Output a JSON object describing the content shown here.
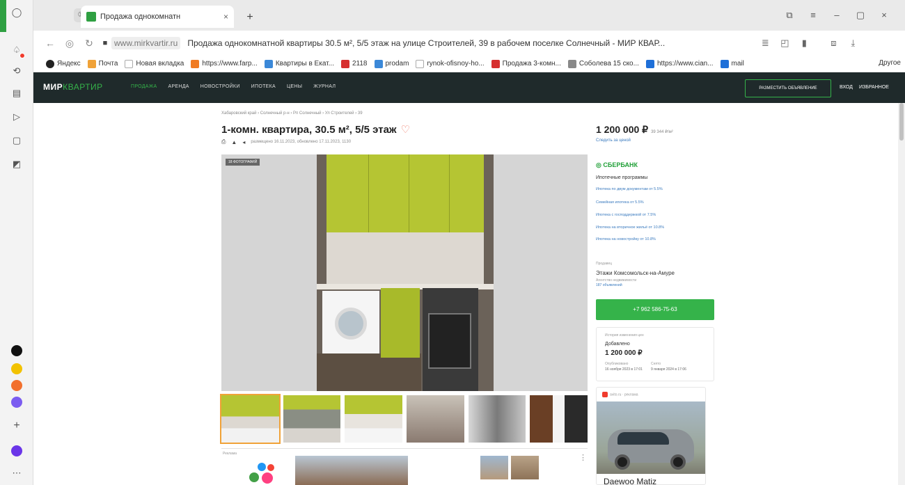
{
  "browser": {
    "tab_title": "Продажа однокомнатн",
    "domain": "www.mirkvartir.ru",
    "page_title": "Продажа однокомнатной квартиры 30.5 м², 5/5 этаж на улице Строителей, 39 в рабочем поселке Солнечный - МИР КВАР...",
    "bookmarks": [
      {
        "label": "Яндекс",
        "color": "#222222"
      },
      {
        "label": "Почта",
        "color": "#f0a238"
      },
      {
        "label": "Новая вкладка",
        "color": "#bdbdbd"
      },
      {
        "label": "https://www.farp...",
        "color": "#f07b22"
      },
      {
        "label": "Квартиры в Екат...",
        "color": "#3b88d8"
      },
      {
        "label": "2118",
        "color": "#d62f2f"
      },
      {
        "label": "prodam",
        "color": "#3b88d8"
      },
      {
        "label": "rynok-ofisnoy-ho...",
        "color": "#bdbdbd"
      },
      {
        "label": "Продажа 3-комн...",
        "color": "#d62f2f"
      },
      {
        "label": "Соболева 15 ско...",
        "color": "#888888"
      },
      {
        "label": "https://www.cian...",
        "color": "#1e6fd8"
      },
      {
        "label": "mail",
        "color": "#1e6fd8"
      }
    ],
    "other_bookmarks": "Другое"
  },
  "site": {
    "logo_a": "МИР",
    "logo_b": "КВАРТИР",
    "menu": [
      "ПРОДАЖА",
      "АРЕНДА",
      "НОВОСТРОЙКИ",
      "ИПОТЕКА",
      "ЦЕНЫ",
      "ЖУРНАЛ"
    ],
    "post_ad": "РАЗМЕСТИТЬ ОБЪЯВЛЕНИЕ",
    "login": "ВХОД",
    "favorites": "ИЗБРАННОЕ"
  },
  "listing": {
    "breadcrumbs": "Хабаровский край › Солнечный р-н › Рп Солнечный › Ул Строителей › 39",
    "title": "1-комн. квартира, 30.5 м², 5/5 этаж",
    "meta": "размещено 16.11.2023, обновлено 17.11.2023, 1130",
    "photo_tag": "18 ФОТОГРАФИЙ",
    "price": "1 200 000 ₽",
    "price_per_m2": "39 344 ₽/м²",
    "track_price": "Следить за ценой",
    "bank": "СБЕРБАНК",
    "mortgage_title": "Ипотечные программы",
    "mortgages": [
      "Ипотека по двум документам от 5.5%",
      "Семейная ипотека от 5.5%",
      "Ипотека с господдержкой от 7.5%",
      "Ипотека на вторичное жильё от 10.8%",
      "Ипотека на новостройку от 10.8%"
    ],
    "seller_label": "Продавец",
    "agency": "Этажи Комсомольск-на-Амуре",
    "agency_sub": "Агентство недвижимости",
    "agency_count": "187 объявлений",
    "phone": "+7 962 586-75-63",
    "history_label": "История изменения цен",
    "history_kind": "Добавлено",
    "history_price": "1 200 000 ₽",
    "history_date1_label": "Опубликовано",
    "history_date1": "16 ноября 2023 в 17:01",
    "history_date2_label": "Снято",
    "history_date2": "9 января 2024 в 17:06",
    "ad_label": "Реклама",
    "ad2_top": "avito.ru · реклама",
    "ad2_name": "Daewoo Matiz"
  }
}
